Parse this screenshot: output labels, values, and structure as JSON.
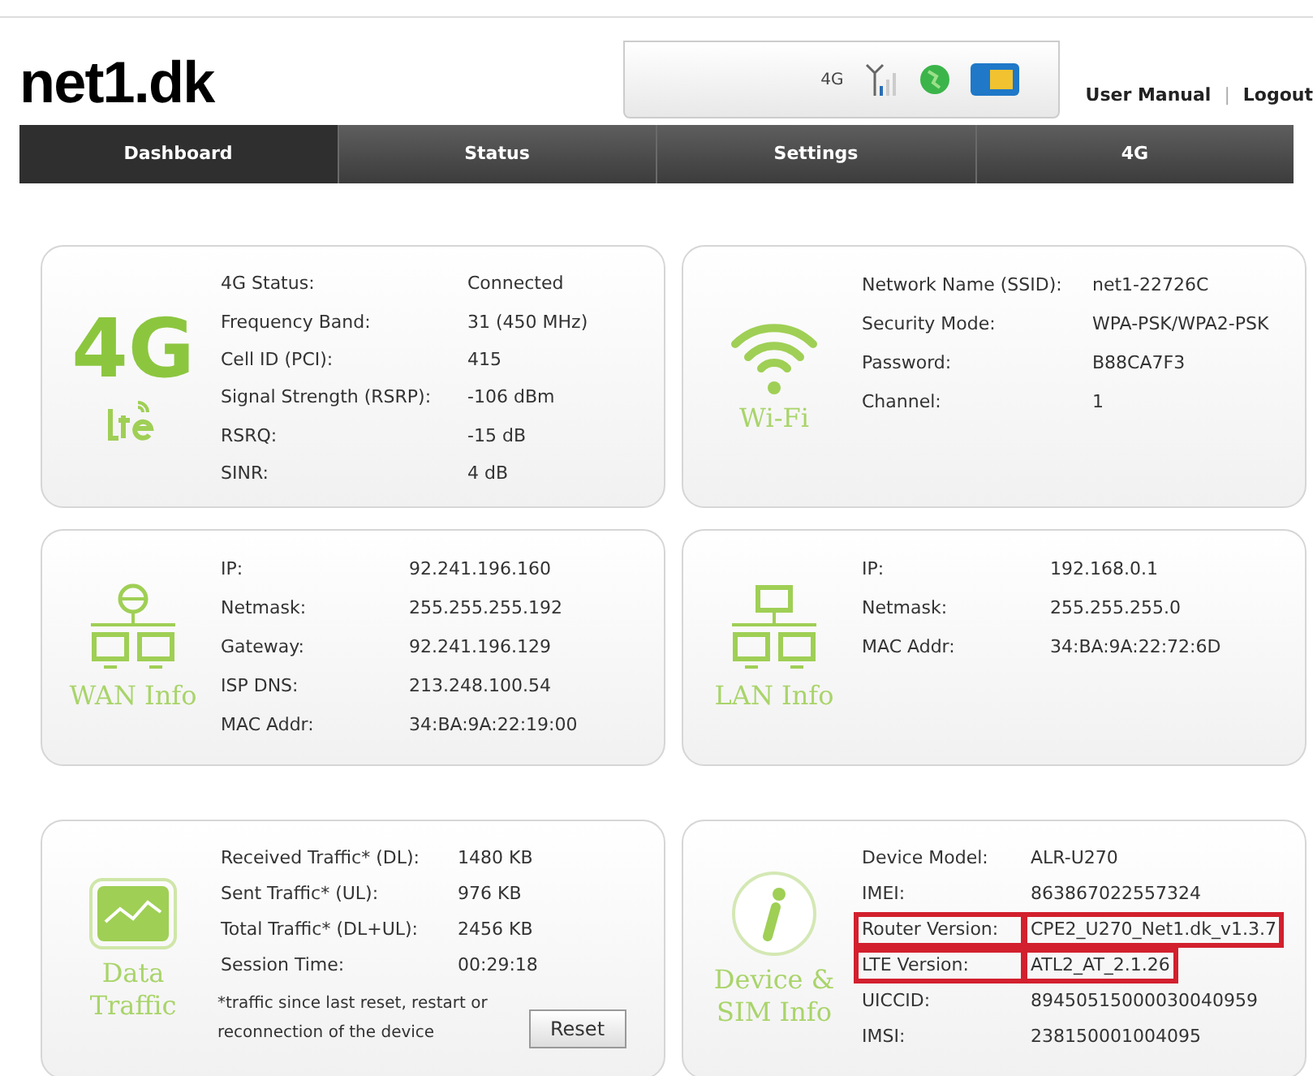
{
  "header": {
    "logo": "net1.dk",
    "status": {
      "network": "4G"
    },
    "links": [
      "User Manual",
      "Logout"
    ],
    "separator": "|"
  },
  "tabs": [
    {
      "label": "Dashboard",
      "selected": true
    },
    {
      "label": "Status",
      "selected": false
    },
    {
      "label": "Settings",
      "selected": false
    },
    {
      "label": "4G",
      "selected": false
    }
  ],
  "cards": [
    {
      "kind": "lte",
      "title": "4G",
      "rows": [
        {
          "label": "4G Status:",
          "value": "Connected"
        },
        {
          "label": "Frequency Band:",
          "value": "31 (450 MHz)"
        },
        {
          "label": "Cell ID (PCI):",
          "value": "415"
        },
        {
          "label": "Signal Strength (RSRP):",
          "value": "-106 dBm"
        },
        {
          "label": "RSRQ:",
          "value": "-15 dB"
        },
        {
          "label": "SINR:",
          "value": "4 dB"
        }
      ]
    },
    {
      "kind": "wifi",
      "title": "Wi-Fi",
      "rows": [
        {
          "label": "Network Name (SSID):",
          "value": "net1-22726C"
        },
        {
          "label": "Security Mode:",
          "value": "WPA-PSK/WPA2-PSK"
        },
        {
          "label": "Password:",
          "value": "B88CA7F3"
        },
        {
          "label": "Channel:",
          "value": "1"
        }
      ]
    },
    {
      "kind": "wan",
      "title": "WAN Info",
      "rows": [
        {
          "label": "IP:",
          "value": "92.241.196.160"
        },
        {
          "label": "Netmask:",
          "value": "255.255.255.192"
        },
        {
          "label": "Gateway:",
          "value": "92.241.196.129"
        },
        {
          "label": "ISP DNS:",
          "value": "213.248.100.54"
        },
        {
          "label": "MAC Addr:",
          "value": "34:BA:9A:22:19:00"
        }
      ]
    },
    {
      "kind": "lan",
      "title": "LAN Info",
      "rows": [
        {
          "label": "IP:",
          "value": "192.168.0.1"
        },
        {
          "label": "Netmask:",
          "value": "255.255.255.0"
        },
        {
          "label": "MAC Addr:",
          "value": "34:BA:9A:22:72:6D"
        }
      ]
    },
    {
      "kind": "traffic",
      "title": "Data Traffic",
      "rows": [
        {
          "label": "Received Traffic* (DL):",
          "value": "1480 KB"
        },
        {
          "label": "Sent Traffic* (UL):",
          "value": "976 KB"
        },
        {
          "label": "Total Traffic* (DL+UL):",
          "value": "2456 KB"
        },
        {
          "label": "Session Time:",
          "value": "00:29:18"
        }
      ],
      "note": "*traffic since last reset, restart or reconnection of the device",
      "button": "Reset"
    },
    {
      "kind": "device",
      "title": "Device & SIM Info",
      "rows": [
        {
          "label": "Device Model:",
          "value": "ALR-U270",
          "highlighted": false
        },
        {
          "label": "IMEI:",
          "value": "863867022557324",
          "highlighted": false
        },
        {
          "label": "Router Version:",
          "value": "CPE2_U270_Net1.dk_v1.3.7",
          "highlighted": true
        },
        {
          "label": "LTE Version:",
          "value": "ATL2_AT_2.1.26",
          "highlighted": true
        },
        {
          "label": "UICCID:",
          "value": "89450515000030040959",
          "highlighted": false
        },
        {
          "label": "IMSI:",
          "value": "238150001004095",
          "highlighted": false
        }
      ]
    }
  ]
}
